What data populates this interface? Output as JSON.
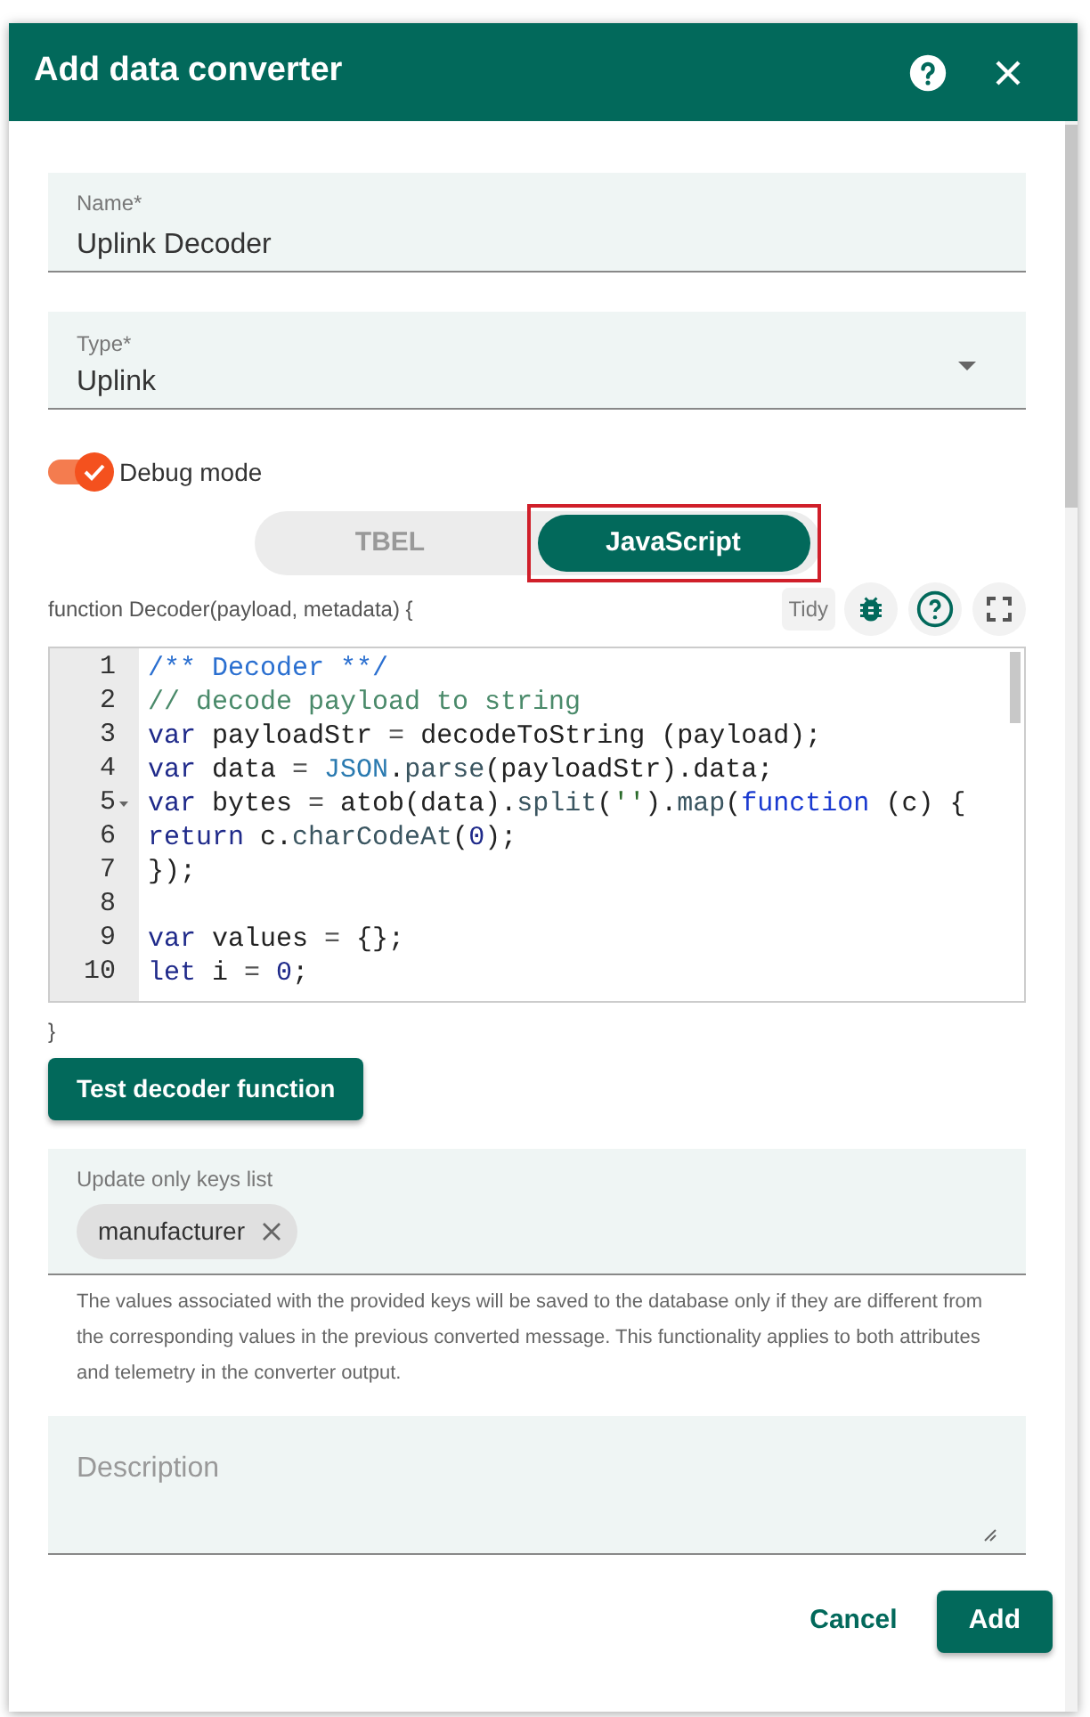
{
  "dialog": {
    "title": "Add data converter"
  },
  "name_field": {
    "label": "Name*",
    "value": "Uplink Decoder"
  },
  "type_field": {
    "label": "Type*",
    "value": "Uplink"
  },
  "debug_mode": {
    "label": "Debug mode",
    "on": true
  },
  "language_tabs": [
    {
      "label": "TBEL",
      "selected": false
    },
    {
      "label": "JavaScript",
      "selected": true
    }
  ],
  "editor": {
    "header": "function Decoder(payload, metadata) {",
    "tidy": "Tidy",
    "footer": "}",
    "lines": [
      {
        "number": "1",
        "fold": false,
        "tokens": [
          {
            "kind": "doc",
            "text": "/** Decoder **/"
          }
        ]
      },
      {
        "number": "2",
        "fold": false,
        "tokens": [
          {
            "kind": "comment",
            "text": "// decode payload to string"
          }
        ]
      },
      {
        "number": "3",
        "fold": false,
        "tokens": [
          {
            "kind": "keyword",
            "text": "var"
          },
          {
            "kind": "plain",
            "text": " payloadStr "
          },
          {
            "kind": "op",
            "text": "="
          },
          {
            "kind": "plain",
            "text": " decodeToString (payload);"
          }
        ]
      },
      {
        "number": "4",
        "fold": false,
        "tokens": [
          {
            "kind": "keyword",
            "text": "var"
          },
          {
            "kind": "plain",
            "text": " data "
          },
          {
            "kind": "op",
            "text": "= "
          },
          {
            "kind": "builtin",
            "text": "JSON"
          },
          {
            "kind": "plain",
            "text": "."
          },
          {
            "kind": "method",
            "text": "parse"
          },
          {
            "kind": "plain",
            "text": "(payloadStr).data;"
          }
        ]
      },
      {
        "number": "5",
        "fold": true,
        "tokens": [
          {
            "kind": "keyword",
            "text": "var"
          },
          {
            "kind": "plain",
            "text": " bytes "
          },
          {
            "kind": "op",
            "text": "="
          },
          {
            "kind": "plain",
            "text": " atob(data)."
          },
          {
            "kind": "method",
            "text": "split"
          },
          {
            "kind": "plain",
            "text": "("
          },
          {
            "kind": "string",
            "text": "''"
          },
          {
            "kind": "plain",
            "text": ")."
          },
          {
            "kind": "method",
            "text": "map"
          },
          {
            "kind": "plain",
            "text": "("
          },
          {
            "kind": "function",
            "text": "function"
          },
          {
            "kind": "plain",
            "text": " (c) {"
          }
        ]
      },
      {
        "number": "6",
        "fold": false,
        "tokens": [
          {
            "kind": "keyword",
            "text": "return"
          },
          {
            "kind": "plain",
            "text": " c."
          },
          {
            "kind": "method",
            "text": "charCodeAt"
          },
          {
            "kind": "plain",
            "text": "("
          },
          {
            "kind": "number",
            "text": "0"
          },
          {
            "kind": "plain",
            "text": ");"
          }
        ]
      },
      {
        "number": "7",
        "fold": false,
        "tokens": [
          {
            "kind": "plain",
            "text": "});"
          }
        ]
      },
      {
        "number": "8",
        "fold": false
      },
      {
        "number": "9",
        "fold": false,
        "tokens": [
          {
            "kind": "keyword",
            "text": "var"
          },
          {
            "kind": "plain",
            "text": " values "
          },
          {
            "kind": "op",
            "text": "="
          },
          {
            "kind": "plain",
            "text": " {};"
          }
        ]
      },
      {
        "number": "10",
        "fold": false,
        "tokens": [
          {
            "kind": "keyword",
            "text": "let"
          },
          {
            "kind": "plain",
            "text": " i "
          },
          {
            "kind": "op",
            "text": "= "
          },
          {
            "kind": "number",
            "text": "0"
          },
          {
            "kind": "plain",
            "text": ";"
          }
        ]
      }
    ]
  },
  "test_button": "Test decoder function",
  "keys_field": {
    "label": "Update only keys list",
    "chips": [
      "manufacturer"
    ],
    "hint": "The values associated with the provided keys will be saved to the database only if they are different from the corresponding values in the previous converted message. This functionality applies to both attributes and telemetry in the converter output."
  },
  "description_field": {
    "placeholder": "Description"
  },
  "actions": [
    {
      "label": "Cancel",
      "kind": "text"
    },
    {
      "label": "Add",
      "kind": "filled"
    }
  ]
}
